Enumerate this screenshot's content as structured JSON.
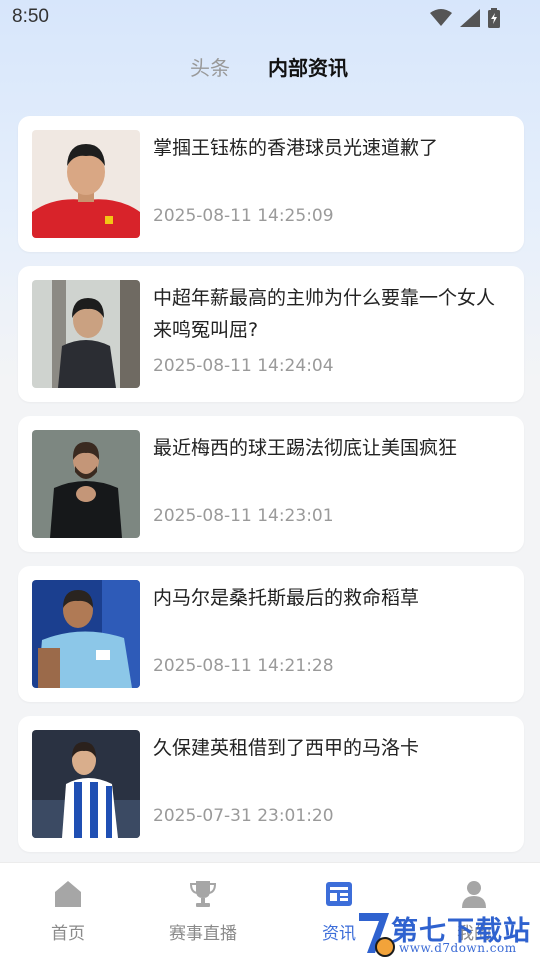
{
  "status_bar": {
    "time": "8:50"
  },
  "top_tabs": {
    "headlines": "头条",
    "internal_news": "内部资讯"
  },
  "news": [
    {
      "title": "掌掴王钰栋的香港球员光速道歉了",
      "time": "2025-08-11 14:25:09"
    },
    {
      "title": "中超年薪最高的主帅为什么要靠一个女人来鸣冤叫屈?",
      "time": "2025-08-11 14:24:04"
    },
    {
      "title": "最近梅西的球王踢法彻底让美国疯狂",
      "time": "2025-08-11 14:23:01"
    },
    {
      "title": "内马尔是桑托斯最后的救命稻草",
      "time": "2025-08-11 14:21:28"
    },
    {
      "title": "久保建英租借到了西甲的马洛卡",
      "time": "2025-07-31 23:01:20"
    }
  ],
  "bottom_nav": {
    "home": "首页",
    "live": "赛事直播",
    "news": "资讯",
    "mine": "我的"
  },
  "watermark": {
    "text": "第七下载站",
    "url": "www.d7down.com"
  },
  "colors": {
    "accent": "#3d6ed9",
    "inactive": "#8a8a8a"
  }
}
